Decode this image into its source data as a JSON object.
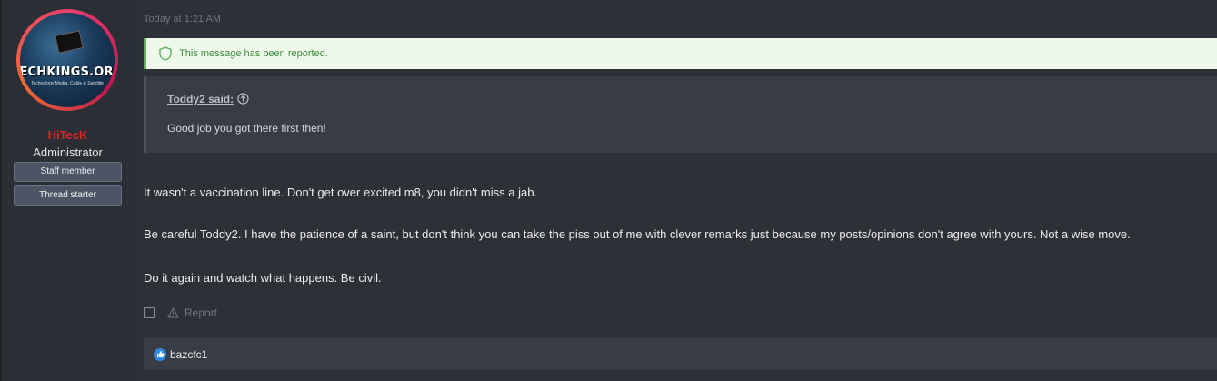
{
  "author": {
    "avatar_logo": "TECHKINGS.ORG",
    "avatar_tagline": "Technology Media, Cable & Satellite",
    "username": "HiTecK",
    "title": "Administrator",
    "banners": [
      "Staff member",
      "Thread starter"
    ]
  },
  "post": {
    "timestamp": "Today at 1:21 AM",
    "reported_notice": "This message has been reported.",
    "quote": {
      "attribution": "Toddy2 said:",
      "body": "Good job you got there first then!"
    },
    "paragraphs": [
      "It wasn't a vaccination line. Don't get over excited m8, you didn't miss a jab.",
      "Be careful Toddy2. I have the patience of a saint, but don't think you can take the piss out of me with clever remarks just because my posts/opinions don't agree with yours. Not a wise move.",
      "Do it again and watch what happens. Be civil."
    ],
    "actions": {
      "report_label": "Report"
    },
    "reactions": {
      "users": "bazcfc1"
    }
  },
  "colors": {
    "username": "#e02525",
    "reported_bg": "#eef9ec",
    "reported_border": "#63b15f",
    "like_icon": "#2f8be0"
  }
}
